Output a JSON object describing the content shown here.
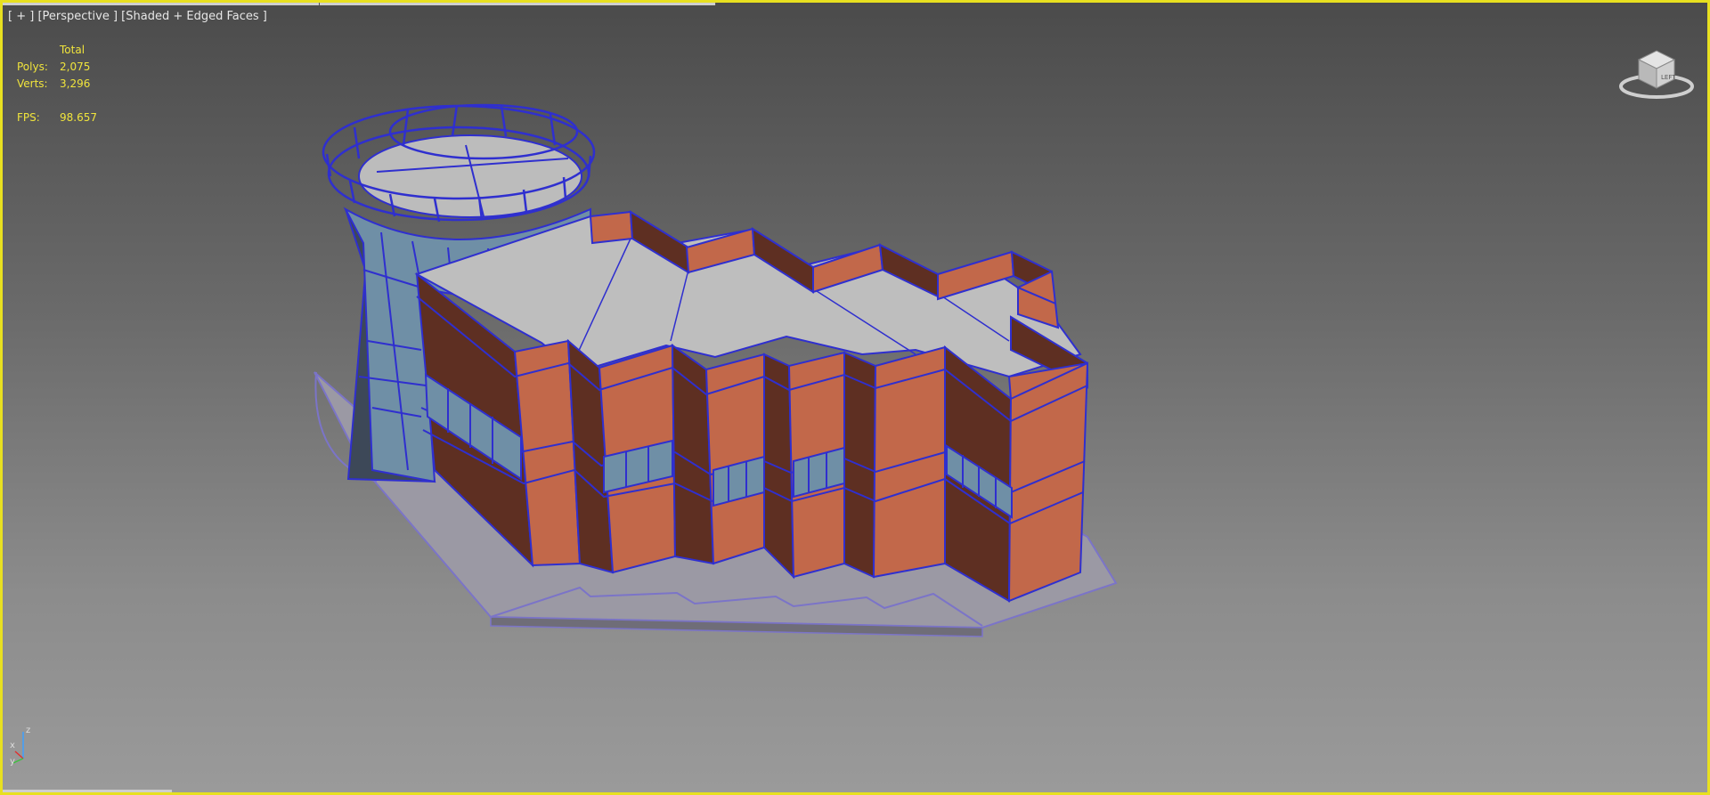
{
  "viewport": {
    "label_plus": "[ + ]",
    "label_view": "[Perspective ]",
    "label_shading": "[Shaded + Edged Faces ]"
  },
  "stats": {
    "header": "Total",
    "polys_label": "Polys:",
    "polys_value": "2,075",
    "verts_label": "Verts:",
    "verts_value": "3,296",
    "fps_label": "FPS:",
    "fps_value": "98.657"
  },
  "viewcube": {
    "face_label": "LEFT"
  },
  "axis_gizmo": {
    "x": "x",
    "y": "y",
    "z": "z"
  },
  "colors": {
    "frame": "#e8e020",
    "stats_text": "#f0e43c",
    "wall_light": "#c2684a",
    "wall_dark": "#5e2f22",
    "roof": "#bdbdbd",
    "glass": "#6f8fa6",
    "edge": "#3a35c8",
    "base": "#9a98a6"
  }
}
